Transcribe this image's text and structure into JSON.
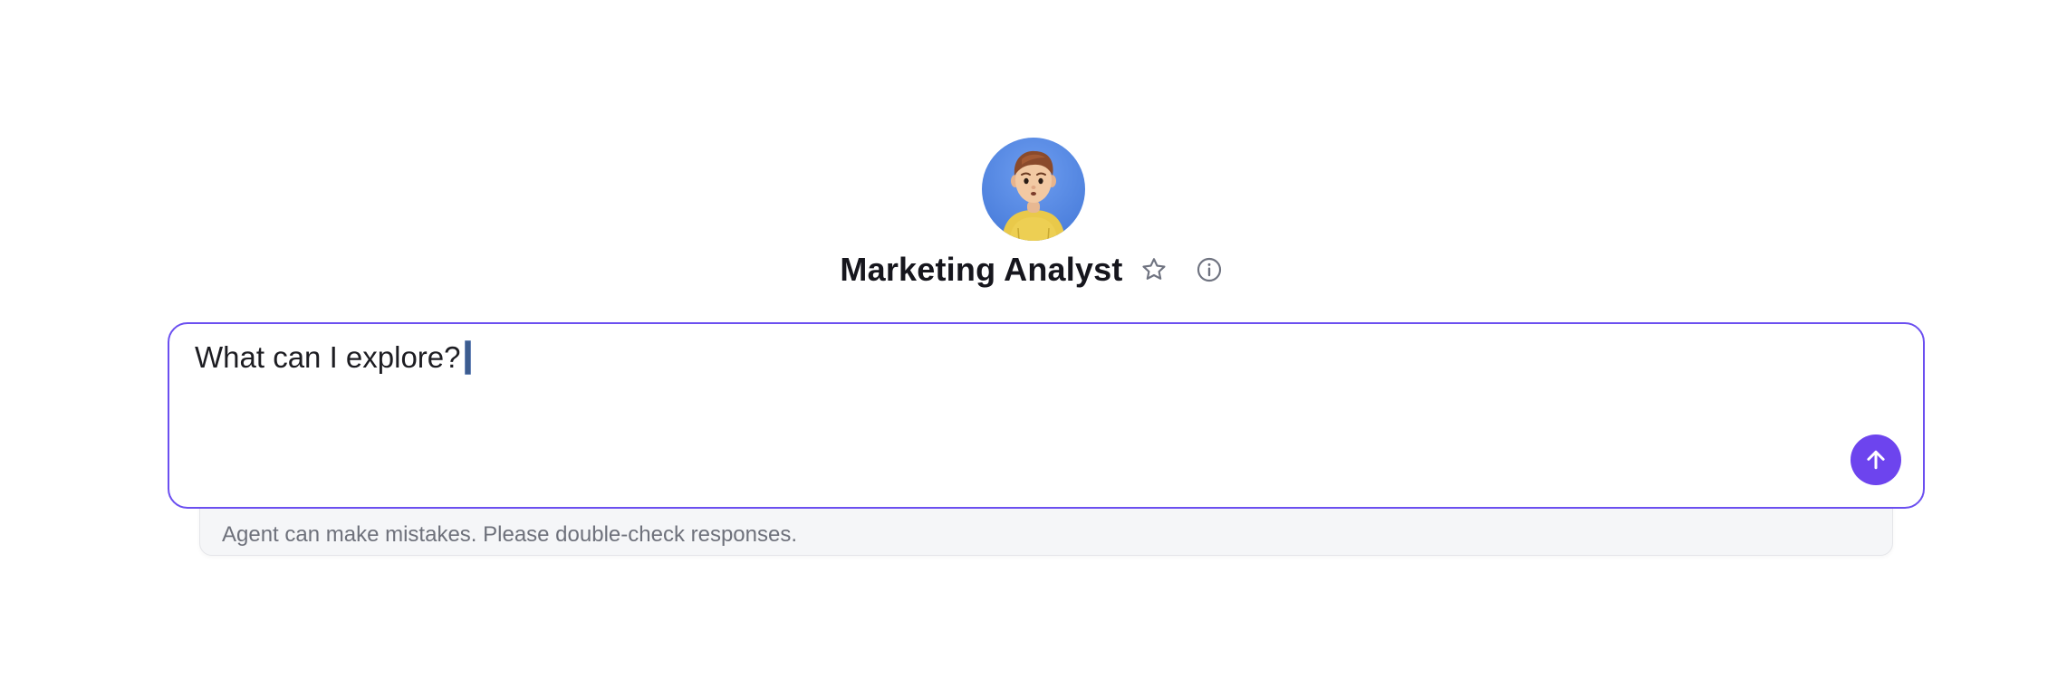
{
  "agent": {
    "name": "Marketing Analyst",
    "avatar_icon": "person-avatar",
    "favorite_icon": "star-icon",
    "info_icon": "info-icon"
  },
  "prompt": {
    "value": "What can I explore?",
    "send_icon": "arrow-up-icon"
  },
  "disclaimer": {
    "text": "Agent can make mistakes. Please double-check responses."
  },
  "colors": {
    "accent": "#6d44ee",
    "border": "#6b4ff0",
    "avatar_bg": "#4f82de"
  }
}
